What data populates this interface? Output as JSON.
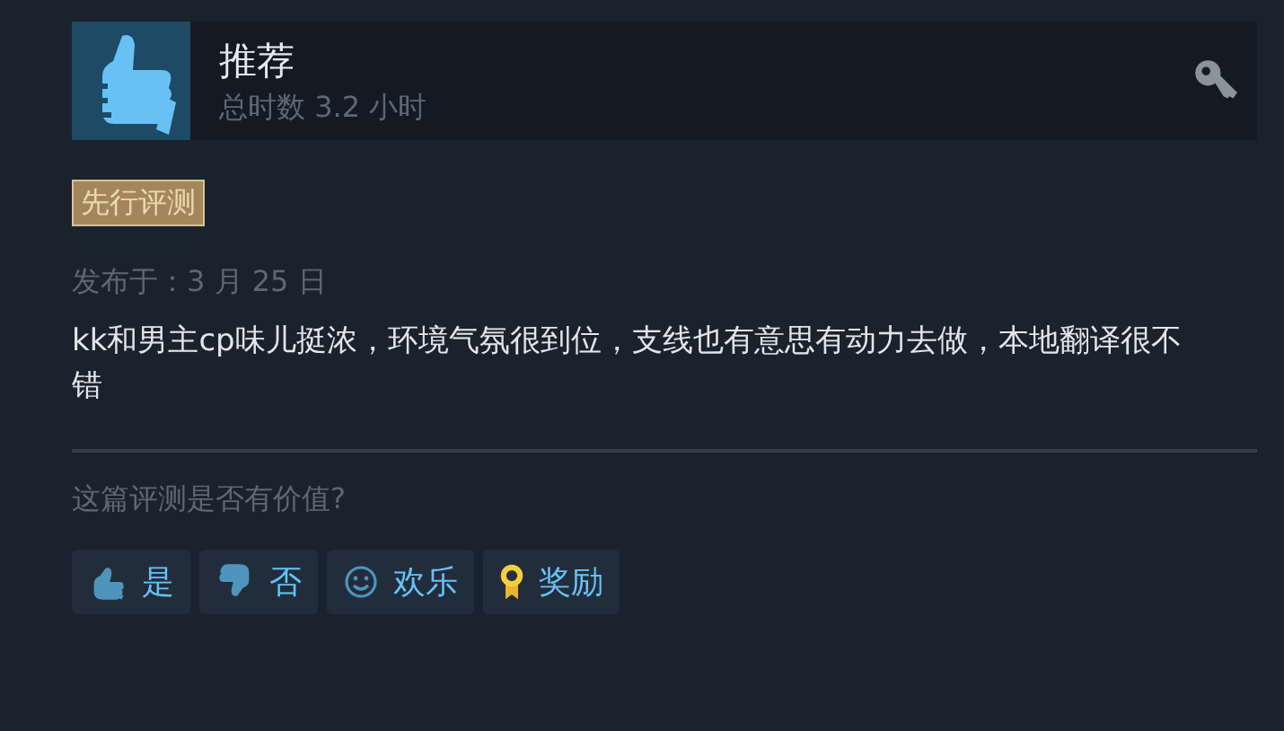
{
  "review": {
    "verdict": "推荐",
    "playtime": "总时数 3.2 小时",
    "badge": "先行评测",
    "posted": "发布于：3 月 25 日",
    "body": "kk和男主cp味儿挺浓，环境气氛很到位，支线也有意思有动力去做，本地翻译很不错"
  },
  "helpful": {
    "question": "这篇评测是否有价值?",
    "buttons": [
      {
        "kind": "yes",
        "label": "是"
      },
      {
        "kind": "no",
        "label": "否"
      },
      {
        "kind": "funny",
        "label": "欢乐"
      },
      {
        "kind": "award",
        "label": "奖励"
      }
    ]
  }
}
